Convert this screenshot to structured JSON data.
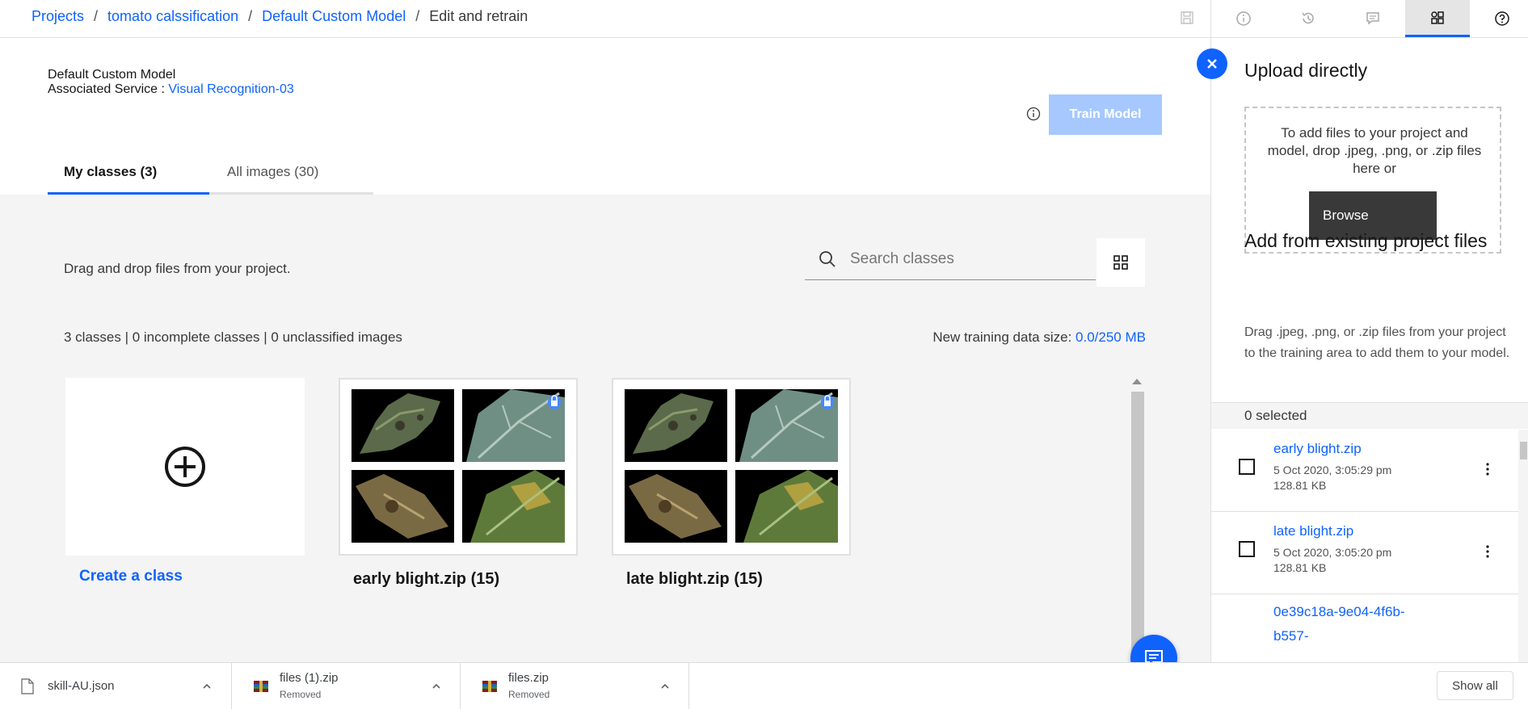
{
  "breadcrumb": {
    "items": [
      "Projects",
      "tomato calssification",
      "Default Custom Model"
    ],
    "separator": "/",
    "current": "Edit and retrain"
  },
  "right_tabs": [
    {
      "icon": "info-icon"
    },
    {
      "icon": "history-icon"
    },
    {
      "icon": "comment-icon"
    },
    {
      "icon": "assets-icon",
      "active": true
    },
    {
      "icon": "help-icon"
    }
  ],
  "model": {
    "name": "Default Custom Model",
    "service_label": "Associated Service :",
    "service_name": "Visual Recognition-03"
  },
  "train_button": "Train Model",
  "tabs": [
    {
      "label": "My classes (3)",
      "active": true
    },
    {
      "label": "All images (30)",
      "active": false
    }
  ],
  "drag_hint": "Drag and drop files from your project.",
  "search": {
    "placeholder": "Search classes"
  },
  "stats": "3 classes | 0 incomplete classes | 0 unclassified images",
  "training_size": {
    "label": "New training data size:",
    "value": "0.0/250 MB"
  },
  "create_class": "Create a class",
  "classes": [
    {
      "label": "early blight.zip (15)"
    },
    {
      "label": "late blight.zip (15)"
    }
  ],
  "right_panel": {
    "upload_title": "Upload directly",
    "drop_text": "To add files to your project and model, drop .jpeg, .png, or .zip files here or",
    "browse_label": "Browse",
    "existing_title": "Add from existing project files",
    "existing_desc": "Drag .jpeg, .png, or .zip files from your project to the training area to add them to your model.",
    "selected": "0 selected",
    "files": [
      {
        "name": "early blight.zip",
        "date": "5 Oct 2020, 3:05:29 pm",
        "size": "128.81 KB"
      },
      {
        "name": "late blight.zip",
        "date": "5 Oct 2020, 3:05:20 pm",
        "size": "128.81 KB"
      },
      {
        "name_lines": [
          "0e39c18a-9e04-4f6b-",
          "b557-"
        ]
      }
    ]
  },
  "downloads": [
    {
      "name": "skill-AU.json",
      "status": ""
    },
    {
      "name": "files (1).zip",
      "status": "Removed"
    },
    {
      "name": "files.zip",
      "status": "Removed"
    }
  ],
  "show_all": "Show all",
  "colors": {
    "accent": "#0f62fe",
    "disabled_button": "#a6c8ff",
    "panel_gray": "#f4f4f4"
  }
}
